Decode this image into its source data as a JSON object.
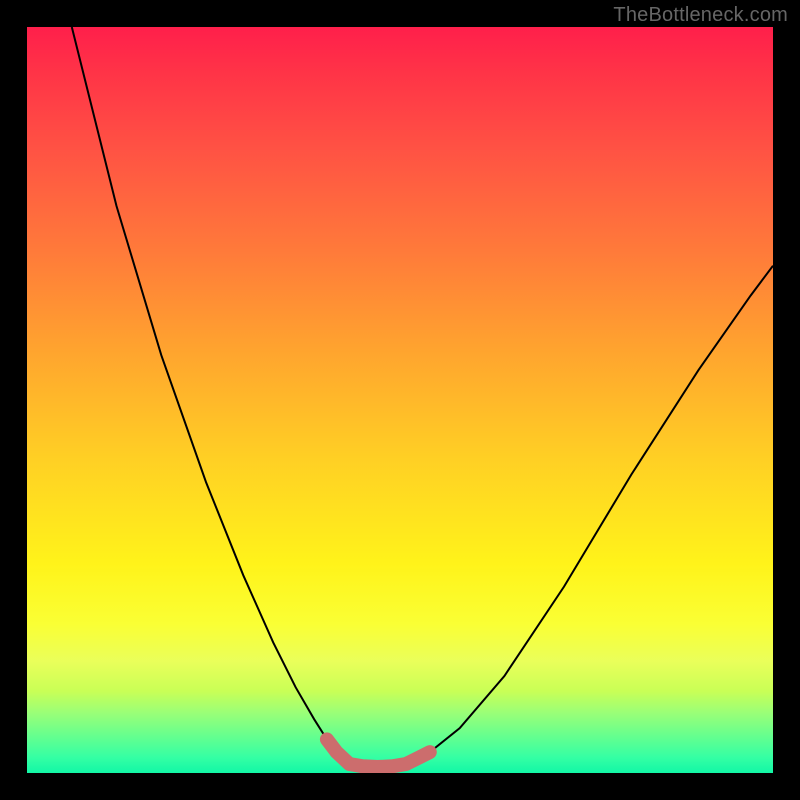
{
  "watermark": "TheBottleneck.com",
  "chart_data": {
    "type": "line",
    "title": "",
    "xlabel": "",
    "ylabel": "",
    "xlim": [
      0,
      1
    ],
    "ylim": [
      0,
      1
    ],
    "background_gradient": {
      "direction": "top-to-bottom",
      "stops": [
        {
          "pos": 0.0,
          "color": "#ff1f4b"
        },
        {
          "pos": 0.3,
          "color": "#ff7a3a"
        },
        {
          "pos": 0.58,
          "color": "#ffd024"
        },
        {
          "pos": 0.8,
          "color": "#faff34"
        },
        {
          "pos": 0.92,
          "color": "#99ff78"
        },
        {
          "pos": 1.0,
          "color": "#12f7a6"
        }
      ]
    },
    "series": [
      {
        "name": "left-curve",
        "x": [
          0.06,
          0.12,
          0.18,
          0.24,
          0.29,
          0.33,
          0.36,
          0.385,
          0.402,
          0.415,
          0.426,
          0.432
        ],
        "y": [
          1.0,
          0.76,
          0.56,
          0.39,
          0.265,
          0.175,
          0.115,
          0.072,
          0.045,
          0.028,
          0.016,
          0.012
        ]
      },
      {
        "name": "trough",
        "x": [
          0.432,
          0.45,
          0.47,
          0.49,
          0.508
        ],
        "y": [
          0.012,
          0.009,
          0.008,
          0.009,
          0.012
        ]
      },
      {
        "name": "right-curve",
        "x": [
          0.508,
          0.54,
          0.58,
          0.64,
          0.72,
          0.81,
          0.9,
          0.97,
          1.0
        ],
        "y": [
          0.012,
          0.028,
          0.06,
          0.13,
          0.25,
          0.4,
          0.54,
          0.64,
          0.68
        ]
      }
    ],
    "highlight": {
      "name": "bottom-marker",
      "color": "#cc6d6d",
      "x": [
        0.402,
        0.415,
        0.432,
        0.45,
        0.47,
        0.49,
        0.508,
        0.524,
        0.54
      ],
      "y": [
        0.045,
        0.028,
        0.012,
        0.009,
        0.008,
        0.009,
        0.012,
        0.02,
        0.028
      ]
    }
  }
}
